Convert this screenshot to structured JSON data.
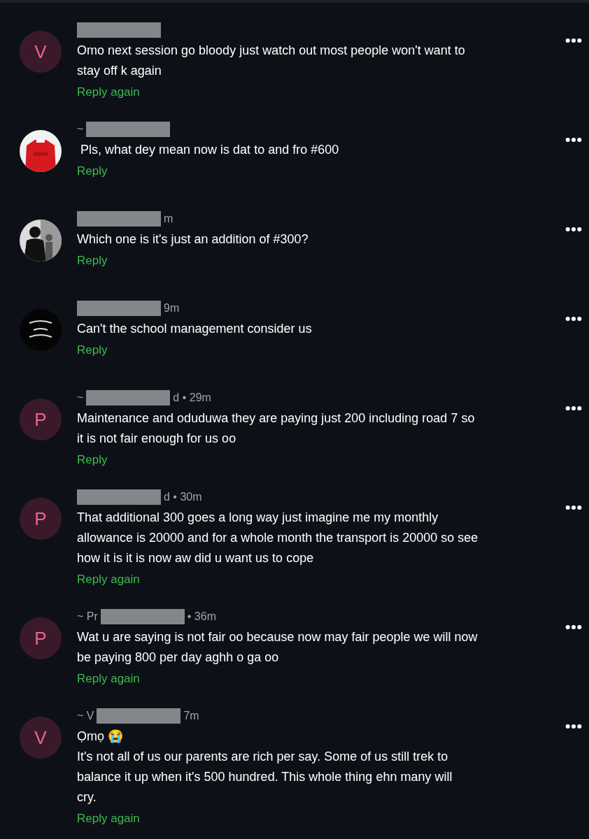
{
  "comments": [
    {
      "avatar": {
        "kind": "letter",
        "letter": "V"
      },
      "lines": [
        "Omo next session go bloody just watch out most people won't want to",
        "stay off k again"
      ],
      "reply": "Reply again"
    },
    {
      "avatar": {
        "kind": "picture"
      },
      "author_before": "~",
      "lines": [
        " Pls, what dey mean now is dat to and fro #600"
      ],
      "reply": "Reply"
    },
    {
      "avatar": {
        "kind": "picture"
      },
      "author_after": "m",
      "lines": [
        "Which one is it's just an addition of #300?"
      ],
      "reply": "Reply"
    },
    {
      "avatar": {
        "kind": "picture"
      },
      "author_after": "9m",
      "lines": [
        "Can't the school management consider us"
      ],
      "reply": "Reply"
    },
    {
      "avatar": {
        "kind": "letter",
        "letter": "P"
      },
      "author_before": "~",
      "author_after": "d • 29m",
      "lines": [
        "Maintenance and oduduwa they are paying just 200 including road 7 so",
        "it is not fair enough for us oo"
      ],
      "reply": "Reply"
    },
    {
      "avatar": {
        "kind": "letter",
        "letter": "P"
      },
      "author_after": "d • 30m",
      "lines": [
        "That additional 300 goes a long way just imagine me my monthly",
        "allowance is 20000 and for a whole month the transport is 20000 so see",
        "how it is it is now aw did u want us to cope"
      ],
      "reply": "Reply again"
    },
    {
      "avatar": {
        "kind": "letter",
        "letter": "P"
      },
      "author_before": "~ Pr",
      "author_after": "• 36m",
      "lines": [
        "Wat u are saying is not fair oo because now may fair people we will now",
        "be paying 800 per day aghh o ga oo"
      ],
      "reply": "Reply again"
    },
    {
      "avatar": {
        "kind": "letter",
        "letter": "V"
      },
      "author_before": "~ V",
      "author_after": "7m",
      "lines": [
        "Ọmọ 😭",
        "It's not all of us our parents are rich per say. Some of us still trek to",
        "balance it up when it's 500 hundred. This whole thing ehn many will",
        "cry."
      ],
      "reply": "Reply again"
    }
  ]
}
